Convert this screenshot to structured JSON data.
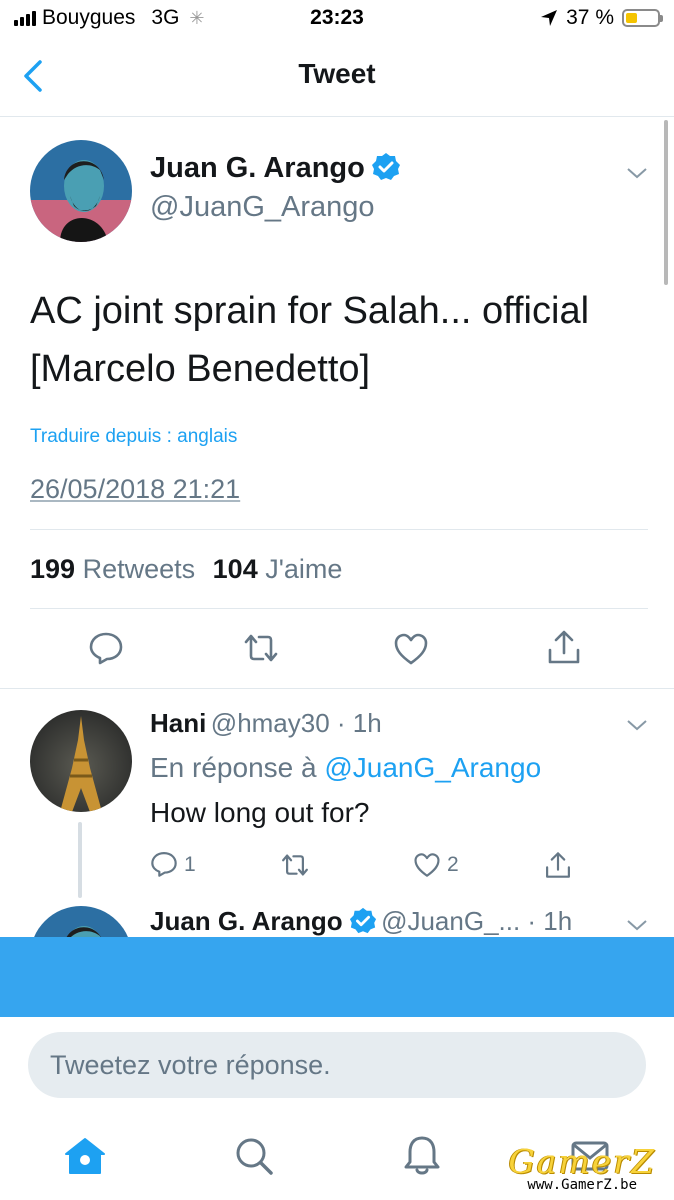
{
  "status_bar": {
    "carrier": "Bouygues",
    "network": "3G",
    "time": "23:23",
    "battery": "37 %",
    "battery_level": 0.37
  },
  "nav": {
    "title": "Tweet"
  },
  "tweet": {
    "author_name": "Juan G. Arango",
    "author_handle": "@JuanG_Arango",
    "text_line1": "AC joint sprain for Salah... official",
    "text_line2": "[Marcelo Benedetto]",
    "translate": "Traduire depuis : anglais",
    "timestamp": "26/05/2018 21:21",
    "retweets_count": "199",
    "retweets_label": "Retweets",
    "likes_count": "104",
    "likes_label": "J'aime"
  },
  "reply": {
    "name": "Hani",
    "handle_time": "@hmay30 · 1h",
    "reply_to_prefix": "En réponse à",
    "reply_to_handle": "@JuanG_Arango",
    "text": "How long out for?",
    "reply_count": "1",
    "like_count": "2"
  },
  "next_tweet": {
    "name": "Juan G. Arango",
    "meta": "@JuanG_... · 1h"
  },
  "compose": {
    "placeholder": "Tweetez votre réponse."
  },
  "watermark": {
    "logo": "GamerZ",
    "url": "www.GamerZ.be"
  },
  "colors": {
    "accent": "#1da1f2",
    "banner": "#36a5ef",
    "text": "#14171a",
    "muted": "#657786"
  },
  "icons": [
    "back-chevron-icon",
    "verified-badge-icon",
    "chevron-down-icon",
    "reply-icon",
    "retweet-icon",
    "like-icon",
    "share-icon",
    "home-icon",
    "search-icon",
    "notifications-icon",
    "messages-icon"
  ]
}
